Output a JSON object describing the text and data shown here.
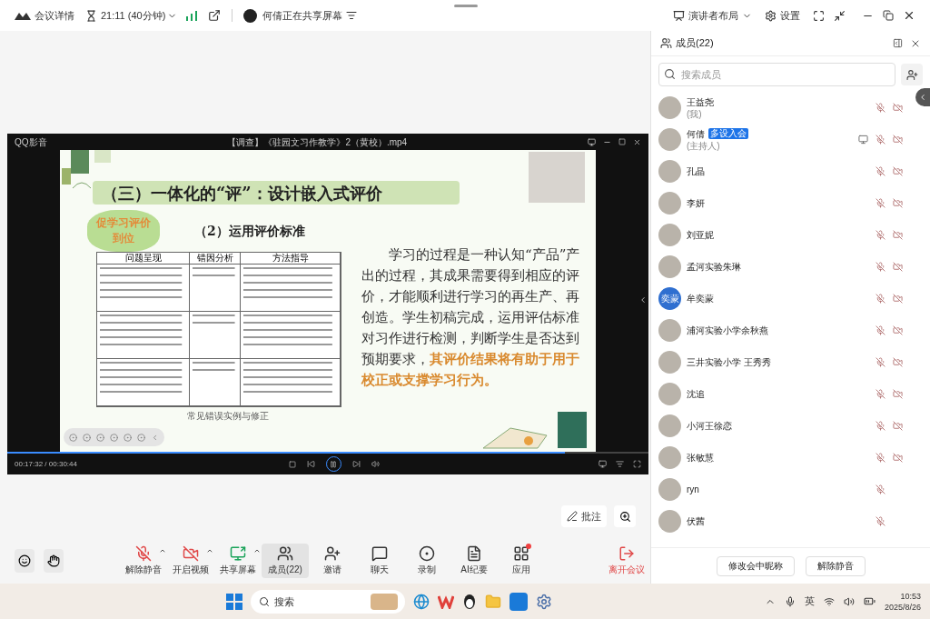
{
  "top_bar": {
    "meeting_info": "会议详情",
    "duration": "21:11 (40分钟)",
    "sharing_notice": "何倩正在共享屏幕",
    "layout": "演讲者布局",
    "settings": "设置"
  },
  "player": {
    "app": "QQ影音",
    "file": "【调查】《驻园文习作教学》2（黄校）.mp4",
    "time": "00:17:32 / 00:30:44",
    "level": 0.87,
    "playing": true
  },
  "slide": {
    "title": "（三）一体化的“评”：设计嵌入式评价",
    "bubble": "促学习评价到位",
    "subtitle": "（2）运用评价标准",
    "table": {
      "columns": [
        "问题呈现",
        "错因分析",
        "方法指导"
      ]
    },
    "caption": "常见错误实例与修正",
    "paragraph": "学习的过程是一种认知“产品”产出的过程，其成果需要得到相应的评价，才能顺利进行学习的再生产、再创造。学生初稿完成，运用评估标准对习作进行检测，判断学生是否达到预期要求，",
    "highlight": "其评价结果将有助于用于校正或支撑学习行为。"
  },
  "annotate": "批注",
  "members_panel": {
    "title": "成员(22)",
    "search": {
      "placeholder": "搜索成员"
    },
    "members": [
      {
        "name": "王益尧",
        "role": "(我)",
        "sharing": false,
        "has_camera": true
      },
      {
        "name": "何倩",
        "badge": "多设入会",
        "role": "(主持人)",
        "sharing": true,
        "has_camera": true
      },
      {
        "name": "孔晶",
        "sharing": false,
        "has_camera": true
      },
      {
        "name": "李妍",
        "sharing": false,
        "has_camera": true
      },
      {
        "name": "刘亚妮",
        "sharing": false,
        "has_camera": true
      },
      {
        "name": "孟河实验朱琳",
        "sharing": false,
        "has_camera": true
      },
      {
        "name": "牟奕蒙",
        "avatar_text": "奕蒙",
        "sharing": false,
        "has_camera": true
      },
      {
        "name": "浦河实验小学余秋燕",
        "sharing": false,
        "has_camera": true
      },
      {
        "name": "三井实验小学 王秀秀",
        "sharing": false,
        "has_camera": true
      },
      {
        "name": "沈追",
        "sharing": false,
        "has_camera": true
      },
      {
        "name": "小河王徐恋",
        "sharing": false,
        "has_camera": true
      },
      {
        "name": "张敏慧",
        "sharing": false,
        "has_camera": true
      },
      {
        "name": "ryn",
        "sharing": false,
        "has_camera": false
      },
      {
        "name": "伏茜",
        "sharing": false,
        "has_camera": false
      }
    ],
    "buttons": [
      "修改会中昵称",
      "解除静音"
    ]
  },
  "toolbar": [
    {
      "kind": "mic",
      "label": "解除静音",
      "caret": true,
      "selected": false
    },
    {
      "kind": "video",
      "label": "开启视频",
      "caret": true,
      "selected": false
    },
    {
      "kind": "share",
      "label": "共享屏幕",
      "caret": true,
      "selected": false
    },
    {
      "kind": "members",
      "label": "成员(22)",
      "caret": false,
      "selected": true
    },
    {
      "kind": "invite",
      "label": "邀请",
      "caret": false,
      "selected": false
    },
    {
      "kind": "chat",
      "label": "聊天",
      "caret": false,
      "selected": false
    },
    {
      "kind": "record",
      "label": "录制",
      "caret": false,
      "selected": false
    },
    {
      "kind": "ai",
      "label": "AI纪要",
      "caret": false,
      "selected": false
    },
    {
      "kind": "apps",
      "label": "应用",
      "caret": false,
      "selected": false
    },
    {
      "kind": "leave",
      "label": "离开会议",
      "caret": false,
      "selected": false
    }
  ],
  "taskbar": {
    "search": {
      "placeholder": "搜索"
    },
    "ime": "英",
    "time": "10:53",
    "date": "2025/8/26"
  }
}
